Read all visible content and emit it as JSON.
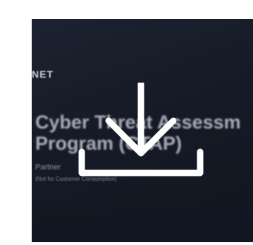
{
  "thumbnail": {
    "brand": "NET",
    "title_line1": "Cyber Threat Assessm",
    "title_line2": "Program (CTAP)",
    "subtitle": "Partner",
    "note": "(Not for Customer Consumption)"
  },
  "overlay": {
    "icon": "download-icon",
    "icon_color": "#ffffff"
  }
}
